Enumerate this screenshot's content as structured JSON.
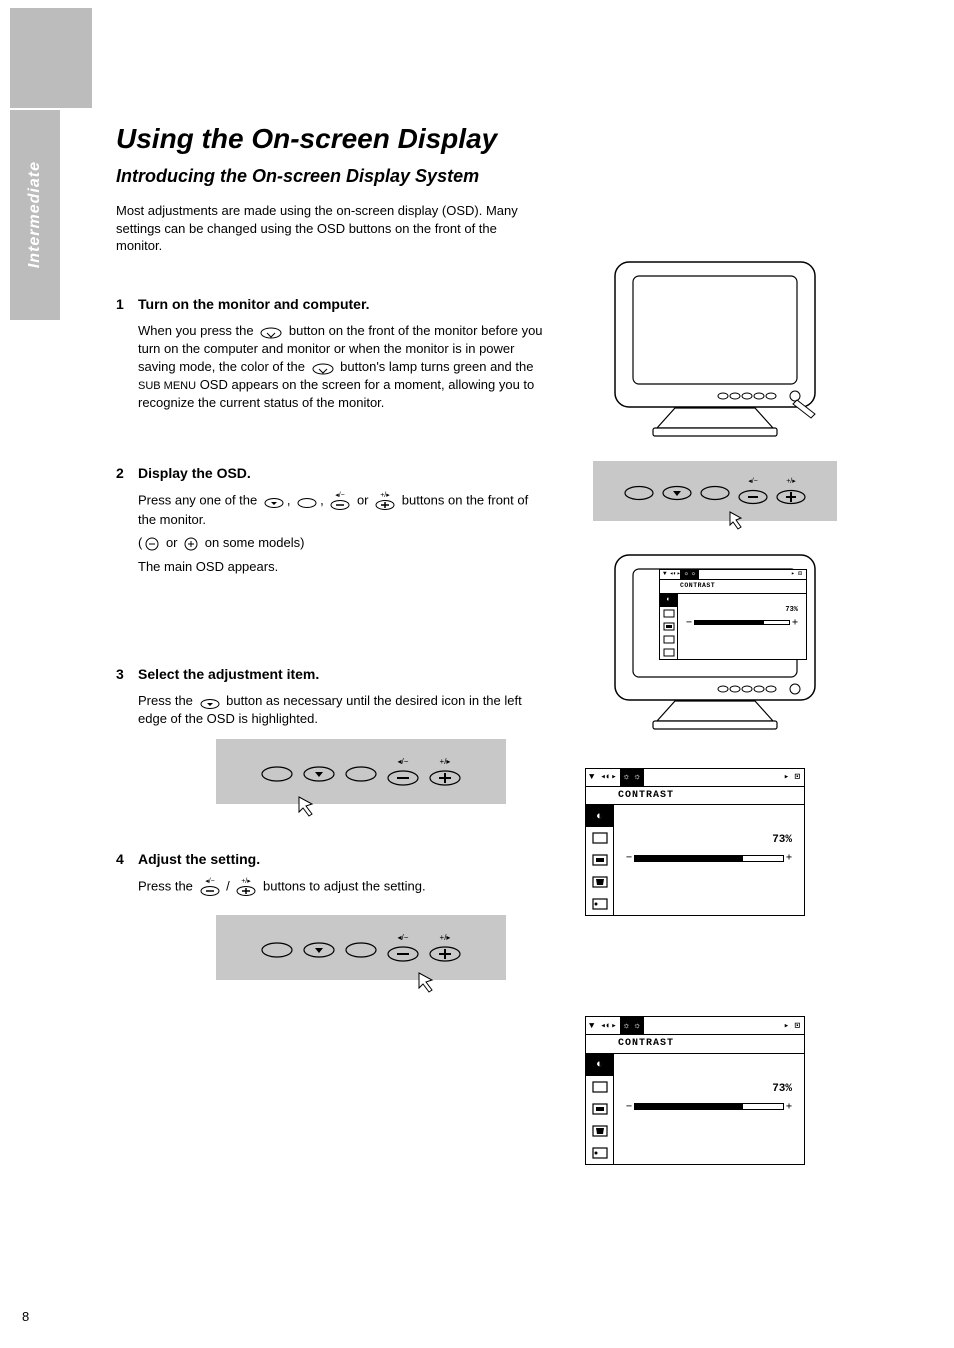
{
  "sidebar_label": "Intermediate",
  "page_number": "8",
  "title": "Using the On-screen Display",
  "intro_heading": "Introducing the On-screen Display System",
  "intro_para": "Most adjustments are made using the on-screen display (OSD). Many settings can be changed using the OSD buttons on the front of the monitor.",
  "step1": {
    "num": "1",
    "heading": "Turn on the monitor and computer.",
    "body_prefix": "When you press the ",
    "body_mid_1": " button on the front of the monitor before you turn on the computer and monitor or when the monitor is in power saving mode, the color of the ",
    "body_mid_2": " button's lamp turns green and the ",
    "body_mid_3": " OSD appears on the screen for a moment, allowing you to recognize the current status of the monitor."
  },
  "step2": {
    "num": "2",
    "heading": "Display the OSD.",
    "body_prefix": "Press any one of the ",
    "body_suffix": " buttons on the front of the monitor.",
    "note": "The main OSD appears."
  },
  "step3": {
    "num": "3",
    "heading": "Select the adjustment item.",
    "body_prefix": "Press the ",
    "body_suffix": " button as necessary until the desired icon in the left edge of the OSD is highlighted."
  },
  "step4": {
    "num": "4",
    "heading": "Adjust the setting.",
    "body_prefix": "Press the ",
    "body_mid": " buttons to adjust the setting."
  },
  "osd": {
    "title": "CONTRAST",
    "percent": "73%",
    "fill_percent": 73,
    "icons": [
      "◐",
      "▭",
      "▭",
      "▭",
      "▭"
    ]
  },
  "icons": {
    "menu_label_minus": "◂/−",
    "menu_label_plus": "+/▸",
    "sub_label": "SUB MENU"
  }
}
